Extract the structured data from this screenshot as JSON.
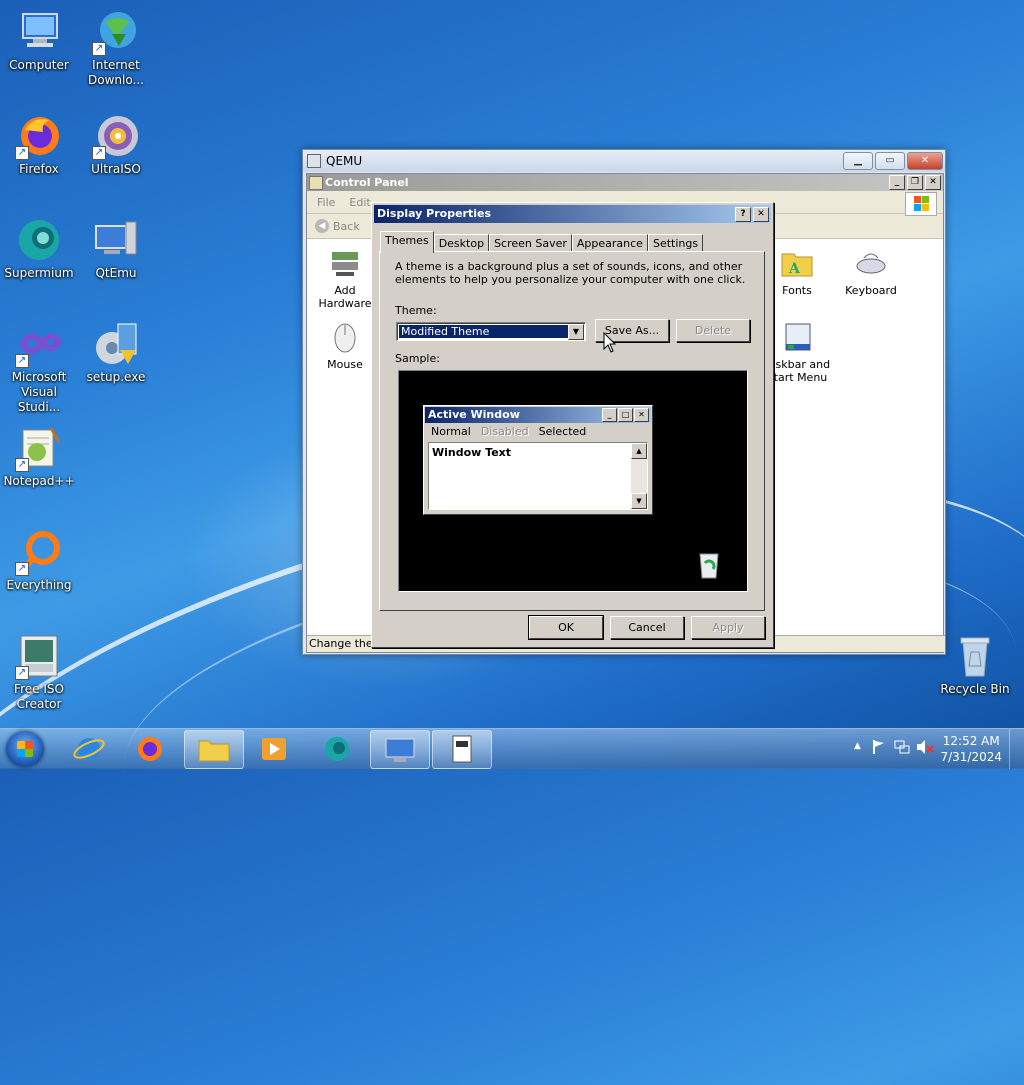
{
  "desktop": {
    "icons": [
      {
        "label": "Computer"
      },
      {
        "label": "Internet Downlo..."
      },
      {
        "label": "Firefox"
      },
      {
        "label": "UltraISO"
      },
      {
        "label": "Supermium"
      },
      {
        "label": "QtEmu"
      },
      {
        "label": "Microsoft Visual Studi..."
      },
      {
        "label": "setup.exe"
      },
      {
        "label": "Notepad++"
      },
      {
        "label": "Everything"
      },
      {
        "label": "Free ISO Creator"
      },
      {
        "label": "Recycle Bin"
      }
    ]
  },
  "qemu": {
    "title": "QEMU"
  },
  "control_panel": {
    "title": "Control Panel",
    "menu": [
      "File",
      "Edit"
    ],
    "toolbar_back": "Back",
    "items": [
      {
        "label": "Add Hardware"
      },
      {
        "label": "Mouse"
      },
      {
        "label": "Fonts"
      },
      {
        "label": "Keyboard"
      },
      {
        "label": "Taskbar and Start Menu"
      }
    ],
    "status": "Change the a"
  },
  "dialog": {
    "title": "Display Properties",
    "tabs": [
      "Themes",
      "Desktop",
      "Screen Saver",
      "Appearance",
      "Settings"
    ],
    "description": "A theme is a background plus a set of sounds, icons, and other elements to help you personalize your computer with one click.",
    "theme_label": "Theme:",
    "theme_value": "Modified Theme",
    "save_as": "Save As...",
    "delete": "Delete",
    "sample_label": "Sample:",
    "ok": "OK",
    "cancel": "Cancel",
    "apply": "Apply",
    "sample": {
      "window_title": "Active Window",
      "menu_normal": "Normal",
      "menu_disabled": "Disabled",
      "menu_selected": "Selected",
      "window_text": "Window Text"
    }
  },
  "taskbar": {
    "time": "12:52 AM",
    "date": "7/31/2024"
  },
  "colors": {
    "dialog_title": "#0a246a",
    "selection": "#0a246a",
    "desktop_blue": "#1e6cc8"
  }
}
